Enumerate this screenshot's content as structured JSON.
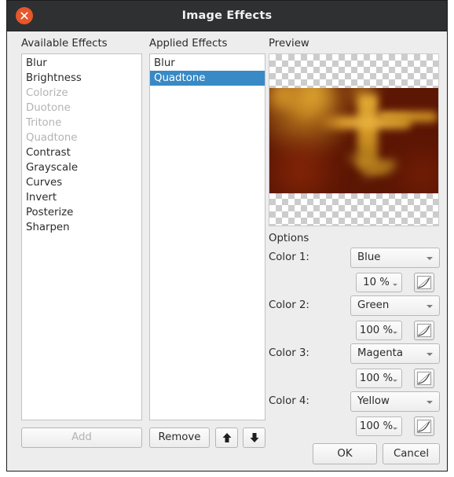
{
  "window": {
    "title": "Image Effects",
    "close_icon": "close-icon"
  },
  "panels": {
    "available_title": "Available Effects",
    "applied_title": "Applied Effects",
    "preview_title": "Preview"
  },
  "available_effects": [
    {
      "label": "Blur",
      "enabled": true
    },
    {
      "label": "Brightness",
      "enabled": true
    },
    {
      "label": "Colorize",
      "enabled": false
    },
    {
      "label": "Duotone",
      "enabled": false
    },
    {
      "label": "Tritone",
      "enabled": false
    },
    {
      "label": "Quadtone",
      "enabled": false
    },
    {
      "label": "Contrast",
      "enabled": true
    },
    {
      "label": "Grayscale",
      "enabled": true
    },
    {
      "label": "Curves",
      "enabled": true
    },
    {
      "label": "Invert",
      "enabled": true
    },
    {
      "label": "Posterize",
      "enabled": true
    },
    {
      "label": "Sharpen",
      "enabled": true
    }
  ],
  "applied_effects": [
    {
      "label": "Blur",
      "selected": false
    },
    {
      "label": "Quadtone",
      "selected": true
    }
  ],
  "options": {
    "title": "Options",
    "rows": [
      {
        "label": "Color 1:",
        "color": "Blue",
        "amount": "10 %"
      },
      {
        "label": "Color 2:",
        "color": "Green",
        "amount": "100 %"
      },
      {
        "label": "Color 3:",
        "color": "Magenta",
        "amount": "100 %"
      },
      {
        "label": "Color 4:",
        "color": "Yellow",
        "amount": "100 %"
      }
    ],
    "curve_icon": "curve-editor-icon"
  },
  "buttons": {
    "add": "Add",
    "add_enabled": false,
    "remove": "Remove",
    "move_up_icon": "arrow-up-icon",
    "move_down_icon": "arrow-down-icon",
    "ok": "OK",
    "cancel": "Cancel"
  },
  "colors": {
    "titlebar": "#2f3032",
    "close_button": "#e8562b",
    "selection": "#3889c5",
    "dialog_bg": "#ededed",
    "preview_image_base": "#5c1604",
    "preview_image_highlight": "#d99a2b"
  }
}
